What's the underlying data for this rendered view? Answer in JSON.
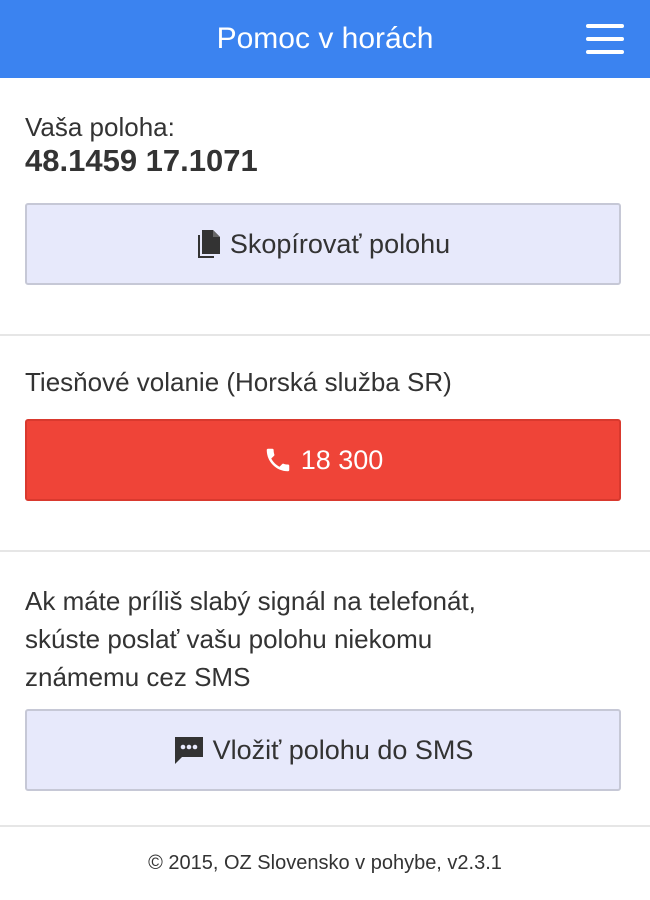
{
  "header": {
    "title": "Pomoc v horách",
    "menu_icon": "hamburger-menu-icon"
  },
  "location": {
    "label": "Vaša poloha:",
    "coordinates": "48.1459 17.1071",
    "copy_button_label": "Skopírovať polohu",
    "copy_icon": "document-copy-icon"
  },
  "emergency": {
    "label": "Tiesňové volanie (Horská služba SR)",
    "call_button_label": "18 300",
    "call_icon": "phone-icon",
    "button_color": "#ef4438"
  },
  "sms": {
    "lines": [
      "Ak máte príliš slabý signál na telefonát,",
      "skúste poslať vašu polohu niekomu",
      "známemu cez SMS"
    ],
    "button_label": "Vložiť polohu do SMS",
    "sms_icon": "message-bubble-icon"
  },
  "footer": {
    "text": "© 2015, OZ Slovensko v pohybe, v2.3.1"
  },
  "colors": {
    "header_blue": "#3b83f0",
    "light_button": "#e7e9fb"
  }
}
